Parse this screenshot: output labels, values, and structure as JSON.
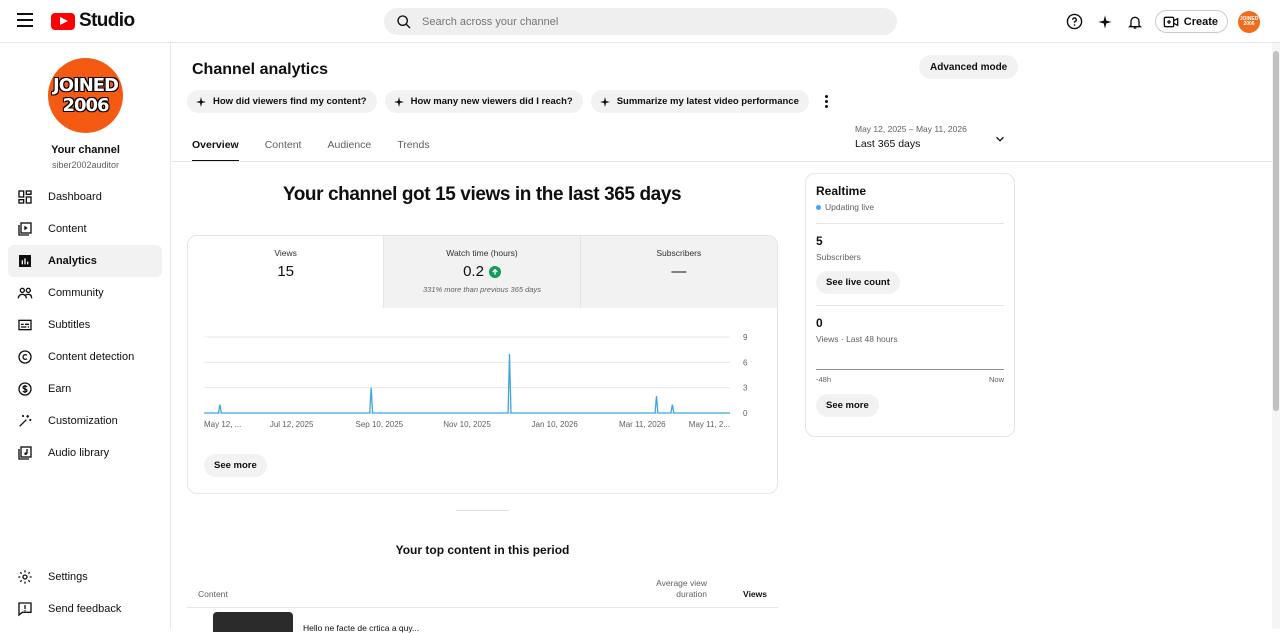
{
  "topbar": {
    "brand": "Studio",
    "search_placeholder": "Search across your channel",
    "create_label": "Create",
    "avatar_text": "JOINED 2006"
  },
  "sidebar": {
    "channel_avatar_text": "JOINED 2006",
    "channel_name": "Your channel",
    "channel_handle": "siber2002auditor",
    "items": [
      {
        "label": "Dashboard",
        "icon": "dashboard-icon"
      },
      {
        "label": "Content",
        "icon": "content-icon"
      },
      {
        "label": "Analytics",
        "icon": "analytics-icon",
        "active": true
      },
      {
        "label": "Community",
        "icon": "community-icon"
      },
      {
        "label": "Subtitles",
        "icon": "subtitles-icon"
      },
      {
        "label": "Content detection",
        "icon": "copyright-icon"
      },
      {
        "label": "Earn",
        "icon": "dollar-icon"
      },
      {
        "label": "Customization",
        "icon": "magic-wand-icon"
      },
      {
        "label": "Audio library",
        "icon": "audio-library-icon"
      }
    ],
    "bottom": [
      {
        "label": "Settings",
        "icon": "gear-icon"
      },
      {
        "label": "Send feedback",
        "icon": "feedback-icon"
      }
    ]
  },
  "main": {
    "title": "Channel analytics",
    "advanced_label": "Advanced mode",
    "chips": [
      "How did viewers find my content?",
      "How many new viewers did I reach?",
      "Summarize my latest video performance"
    ],
    "tabs": [
      "Overview",
      "Content",
      "Audience",
      "Trends"
    ],
    "date_range": {
      "dates": "May 12, 2025 – May 11, 2026",
      "label": "Last 365 days"
    },
    "headline": "Your channel got 15 views in the last 365 days",
    "metrics": [
      {
        "label": "Views",
        "value": "15",
        "note": ""
      },
      {
        "label": "Watch time (hours)",
        "value": "0.2",
        "note": "331% more than previous 365 days"
      },
      {
        "label": "Subscribers",
        "value": "—",
        "note": ""
      }
    ],
    "see_more": "See more",
    "top_content_title": "Your top content in this period",
    "table_head": {
      "content": "Content",
      "avg_view": "Average view duration",
      "views": "Views"
    },
    "first_row_title": "Hello ne facte de crtica a quy..."
  },
  "realtime": {
    "title": "Realtime",
    "status": "Updating live",
    "subscribers_value": "5",
    "subscribers_label": "Subscribers",
    "live_count_btn": "See live count",
    "views_value": "0",
    "views_label": "Views · Last 48 hours",
    "axis_left": "-48h",
    "axis_right": "Now",
    "see_more": "See more"
  },
  "chart_data": {
    "type": "line",
    "x_tick_labels": [
      "May 12, ...",
      "Jul 12, 2025",
      "Sep 10, 2025",
      "Nov 10, 2025",
      "Jan 10, 2026",
      "Mar 11, 2026",
      "May 11, 2..."
    ],
    "y_ticks": [
      0,
      3,
      6,
      9
    ],
    "ylim": [
      0,
      9
    ],
    "xlim_days": [
      0,
      365
    ],
    "series": [
      {
        "color": "#3ea6dd",
        "points": [
          [
            0,
            0
          ],
          [
            10,
            0
          ],
          [
            11,
            1
          ],
          [
            12,
            0
          ],
          [
            115,
            0
          ],
          [
            116,
            3
          ],
          [
            117,
            0
          ],
          [
            211,
            0
          ],
          [
            212,
            7
          ],
          [
            213,
            0
          ],
          [
            313,
            0
          ],
          [
            314,
            2
          ],
          [
            315,
            0
          ],
          [
            324,
            0
          ],
          [
            325,
            1
          ],
          [
            326,
            0
          ],
          [
            365,
            0
          ]
        ]
      }
    ],
    "grid": true
  }
}
